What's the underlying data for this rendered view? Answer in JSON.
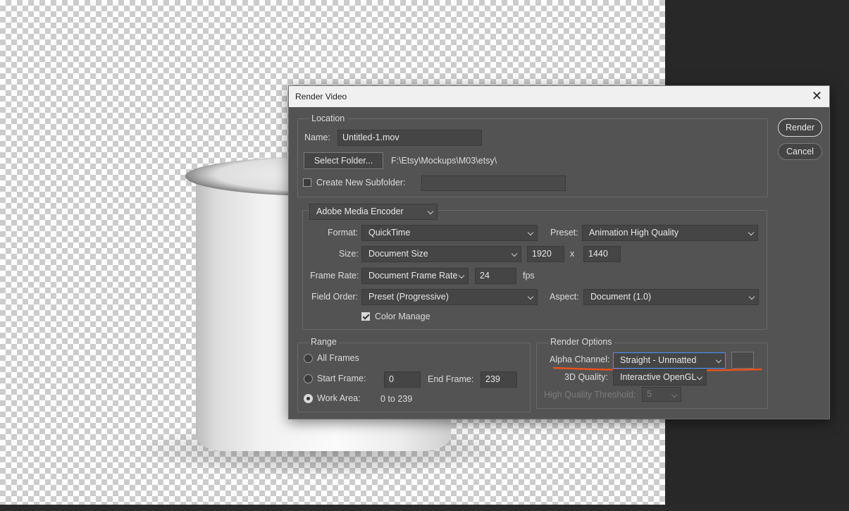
{
  "dialog": {
    "title": "Render Video",
    "render_button": "Render",
    "cancel_button": "Cancel"
  },
  "location": {
    "group_title": "Location",
    "name_label": "Name:",
    "name_value": "Untitled-1.mov",
    "select_folder_button": "Select Folder...",
    "folder_path": "F:\\Etsy\\Mockups\\M03\\etsy\\",
    "subfolder_label": "Create New Subfolder:",
    "subfolder_checked": false,
    "subfolder_value": ""
  },
  "encoder": {
    "selected": "Adobe Media Encoder",
    "format_label": "Format:",
    "format_value": "QuickTime",
    "preset_label": "Preset:",
    "preset_value": "Animation High Quality",
    "size_label": "Size:",
    "size_value": "Document Size",
    "width": "1920",
    "x_sep": "x",
    "height": "1440",
    "frame_rate_label": "Frame Rate:",
    "frame_rate_value": "Document Frame Rate",
    "fps_value": "24",
    "fps_unit": "fps",
    "field_order_label": "Field Order:",
    "field_order_value": "Preset (Progressive)",
    "aspect_label": "Aspect:",
    "aspect_value": "Document (1.0)",
    "color_manage_label": "Color Manage",
    "color_manage_checked": true
  },
  "range": {
    "group_title": "Range",
    "all_frames_label": "All Frames",
    "start_frame_label": "Start Frame:",
    "start_frame_value": "0",
    "end_frame_label": "End Frame:",
    "end_frame_value": "239",
    "work_area_label": "Work Area:",
    "work_area_value": "0 to 239",
    "selected_option": "Work Area"
  },
  "render_options": {
    "group_title": "Render Options",
    "alpha_label": "Alpha Channel:",
    "alpha_value": "Straight - Unmatted",
    "quality_3d_label": "3D Quality:",
    "quality_3d_value": "Interactive OpenGL",
    "hq_threshold_label": "High Quality Threshold:",
    "hq_threshold_value": "5"
  },
  "colors": {
    "dialog_bg": "#535353",
    "field_bg": "#454545",
    "annotation": "#e8531f",
    "focus": "#4d90fe"
  }
}
